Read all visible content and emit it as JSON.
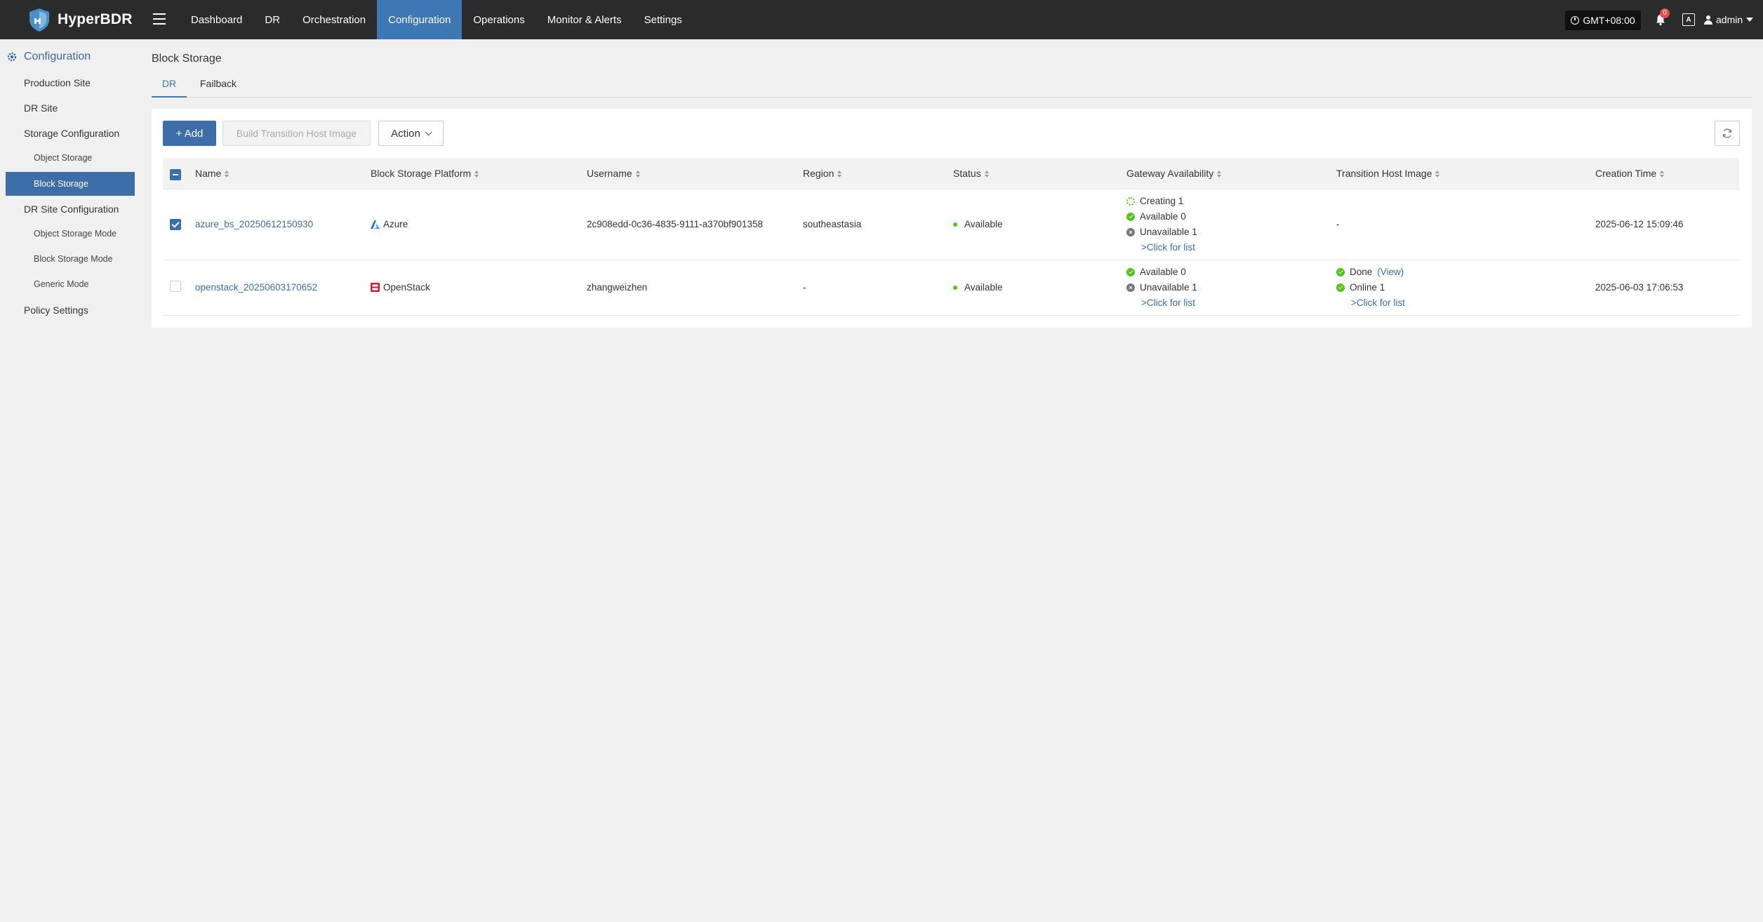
{
  "app": {
    "name": "HyperBDR"
  },
  "nav": {
    "items": [
      "Dashboard",
      "DR",
      "Orchestration",
      "Configuration",
      "Operations",
      "Monitor & Alerts",
      "Settings"
    ],
    "active_index": 3
  },
  "topbar": {
    "timezone": "GMT+08:00",
    "notification_count": "0",
    "lang_icon_text": "A",
    "user": "admin"
  },
  "sidebar": {
    "title": "Configuration",
    "items": [
      {
        "label": "Production Site",
        "level": 1
      },
      {
        "label": "DR Site",
        "level": 1
      },
      {
        "label": "Storage Configuration",
        "level": 1
      },
      {
        "label": "Object Storage",
        "level": 2
      },
      {
        "label": "Block Storage",
        "level": 2,
        "active": true
      },
      {
        "label": "DR Site Configuration",
        "level": 1
      },
      {
        "label": "Object Storage Mode",
        "level": 2
      },
      {
        "label": "Block Storage Mode",
        "level": 2
      },
      {
        "label": "Generic Mode",
        "level": 2
      },
      {
        "label": "Policy Settings",
        "level": 1
      }
    ]
  },
  "page": {
    "title": "Block Storage",
    "tabs": [
      "DR",
      "Failback"
    ],
    "active_tab": 0
  },
  "toolbar": {
    "add_label": "+ Add",
    "build_label": "Build Transition Host Image",
    "action_label": "Action"
  },
  "table": {
    "columns": [
      "Name",
      "Block Storage Platform",
      "Username",
      "Region",
      "Status",
      "Gateway Availability",
      "Transition Host Image",
      "Creation Time"
    ],
    "rows": [
      {
        "checked": true,
        "name": "azure_bs_20250612150930",
        "platform": "Azure",
        "username": "2c908edd-0c36-4835-9111-a370bf901358",
        "region": "southeastasia",
        "status": "Available",
        "gateway": {
          "creating": "Creating 1",
          "available": "Available 0",
          "unavailable": "Unavailable 1",
          "link": ">Click for list"
        },
        "transition": {
          "empty": "-"
        },
        "created": "2025-06-12 15:09:46"
      },
      {
        "checked": false,
        "name": "openstack_20250603170652",
        "platform": "OpenStack",
        "username": "zhangweizhen",
        "region": "-",
        "status": "Available",
        "gateway": {
          "available": "Available 0",
          "unavailable": "Unavailable 1",
          "link": ">Click for list"
        },
        "transition": {
          "done": "Done",
          "view": "(View)",
          "online": "Online 1",
          "link": ">Click for list"
        },
        "created": "2025-06-03 17:06:53"
      }
    ]
  },
  "colors": {
    "brand": "#3d6ea8",
    "topbar": "#2b2b2b",
    "success": "#52c41a",
    "azure": "#0078d4",
    "openstack": "#da1a32"
  },
  "icons": [
    "shield-logo-icon",
    "menu-icon",
    "clock-icon",
    "bell-icon",
    "translate-icon",
    "user-icon",
    "gear-icon",
    "sort-icon",
    "refresh-icon",
    "azure-icon",
    "openstack-icon"
  ]
}
